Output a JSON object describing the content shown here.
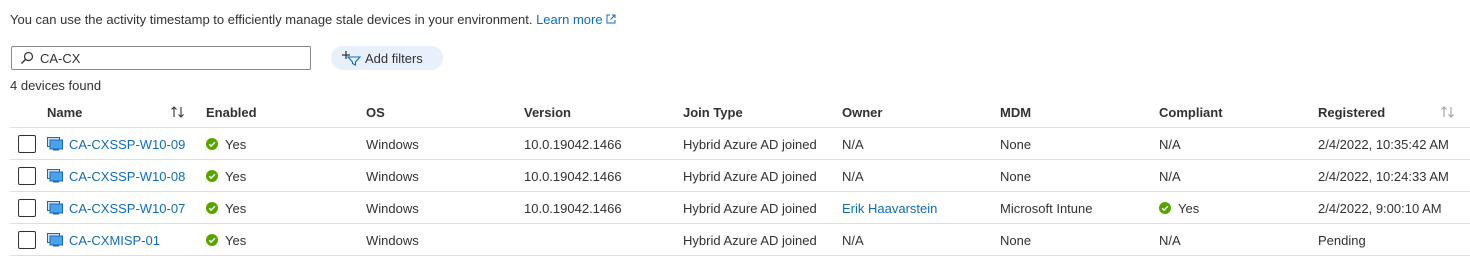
{
  "info": {
    "text": "You can use the activity timestamp to efficiently manage stale devices in your environment.",
    "learn_more": "Learn more"
  },
  "search": {
    "value": "CA-CX"
  },
  "add_filters_label": "Add filters",
  "devices_found": "4 devices found",
  "columns": {
    "name": "Name",
    "enabled": "Enabled",
    "os": "OS",
    "version": "Version",
    "join_type": "Join Type",
    "owner": "Owner",
    "mdm": "MDM",
    "compliant": "Compliant",
    "registered": "Registered"
  },
  "rows": [
    {
      "name": "CA-CXSSP-W10-09",
      "enabled": "Yes",
      "os": "Windows",
      "version": "10.0.19042.1466",
      "join_type": "Hybrid Azure AD joined",
      "owner": "N/A",
      "owner_is_link": false,
      "mdm": "None",
      "compliant": "N/A",
      "compliant_check": false,
      "registered": "2/4/2022, 10:35:42 AM"
    },
    {
      "name": "CA-CXSSP-W10-08",
      "enabled": "Yes",
      "os": "Windows",
      "version": "10.0.19042.1466",
      "join_type": "Hybrid Azure AD joined",
      "owner": "N/A",
      "owner_is_link": false,
      "mdm": "None",
      "compliant": "N/A",
      "compliant_check": false,
      "registered": "2/4/2022, 10:24:33 AM"
    },
    {
      "name": "CA-CXSSP-W10-07",
      "enabled": "Yes",
      "os": "Windows",
      "version": "10.0.19042.1466",
      "join_type": "Hybrid Azure AD joined",
      "owner": "Erik Haavarstein",
      "owner_is_link": true,
      "mdm": "Microsoft Intune",
      "compliant": "Yes",
      "compliant_check": true,
      "registered": "2/4/2022, 9:00:10 AM"
    },
    {
      "name": "CA-CXMISP-01",
      "enabled": "Yes",
      "os": "Windows",
      "version": "",
      "join_type": "Hybrid Azure AD joined",
      "owner": "N/A",
      "owner_is_link": false,
      "mdm": "None",
      "compliant": "N/A",
      "compliant_check": false,
      "registered": "Pending"
    }
  ],
  "colors": {
    "link": "#0f6cbd",
    "success": "#57a300",
    "filter_button_bg": "#e8f1fb",
    "border": "#e1dfdd"
  },
  "icons": {
    "external_link": "external-link-icon",
    "search": "search-icon",
    "add_filter": "add-filter-icon",
    "device": "device-icon",
    "success_check": "success-check-icon",
    "sort": "sort-icon"
  }
}
